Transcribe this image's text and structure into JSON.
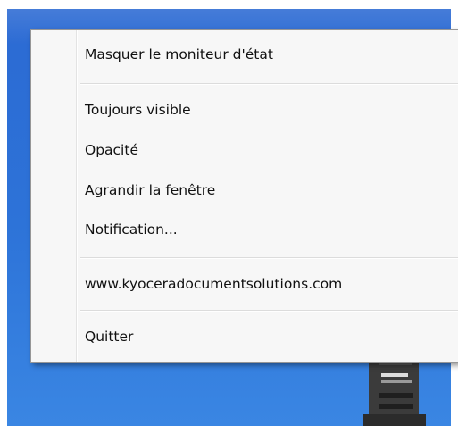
{
  "context_menu": {
    "items": [
      {
        "label": "Masquer le moniteur d'état"
      },
      {
        "label": "Toujours visible"
      },
      {
        "label": "Opacité"
      },
      {
        "label": "Agrandir la fenêtre"
      },
      {
        "label": "Notification..."
      },
      {
        "label": "www.kyoceradocumentsolutions.com"
      },
      {
        "label": "Quitter"
      }
    ]
  },
  "colors": {
    "desktop_blue": "#2d73d8",
    "menu_background": "#f7f7f7",
    "menu_border": "#979797",
    "separator": "#dcdcdc",
    "printer_dark": "#2b2b2b"
  },
  "icons": {
    "printer": "printer-icon"
  }
}
